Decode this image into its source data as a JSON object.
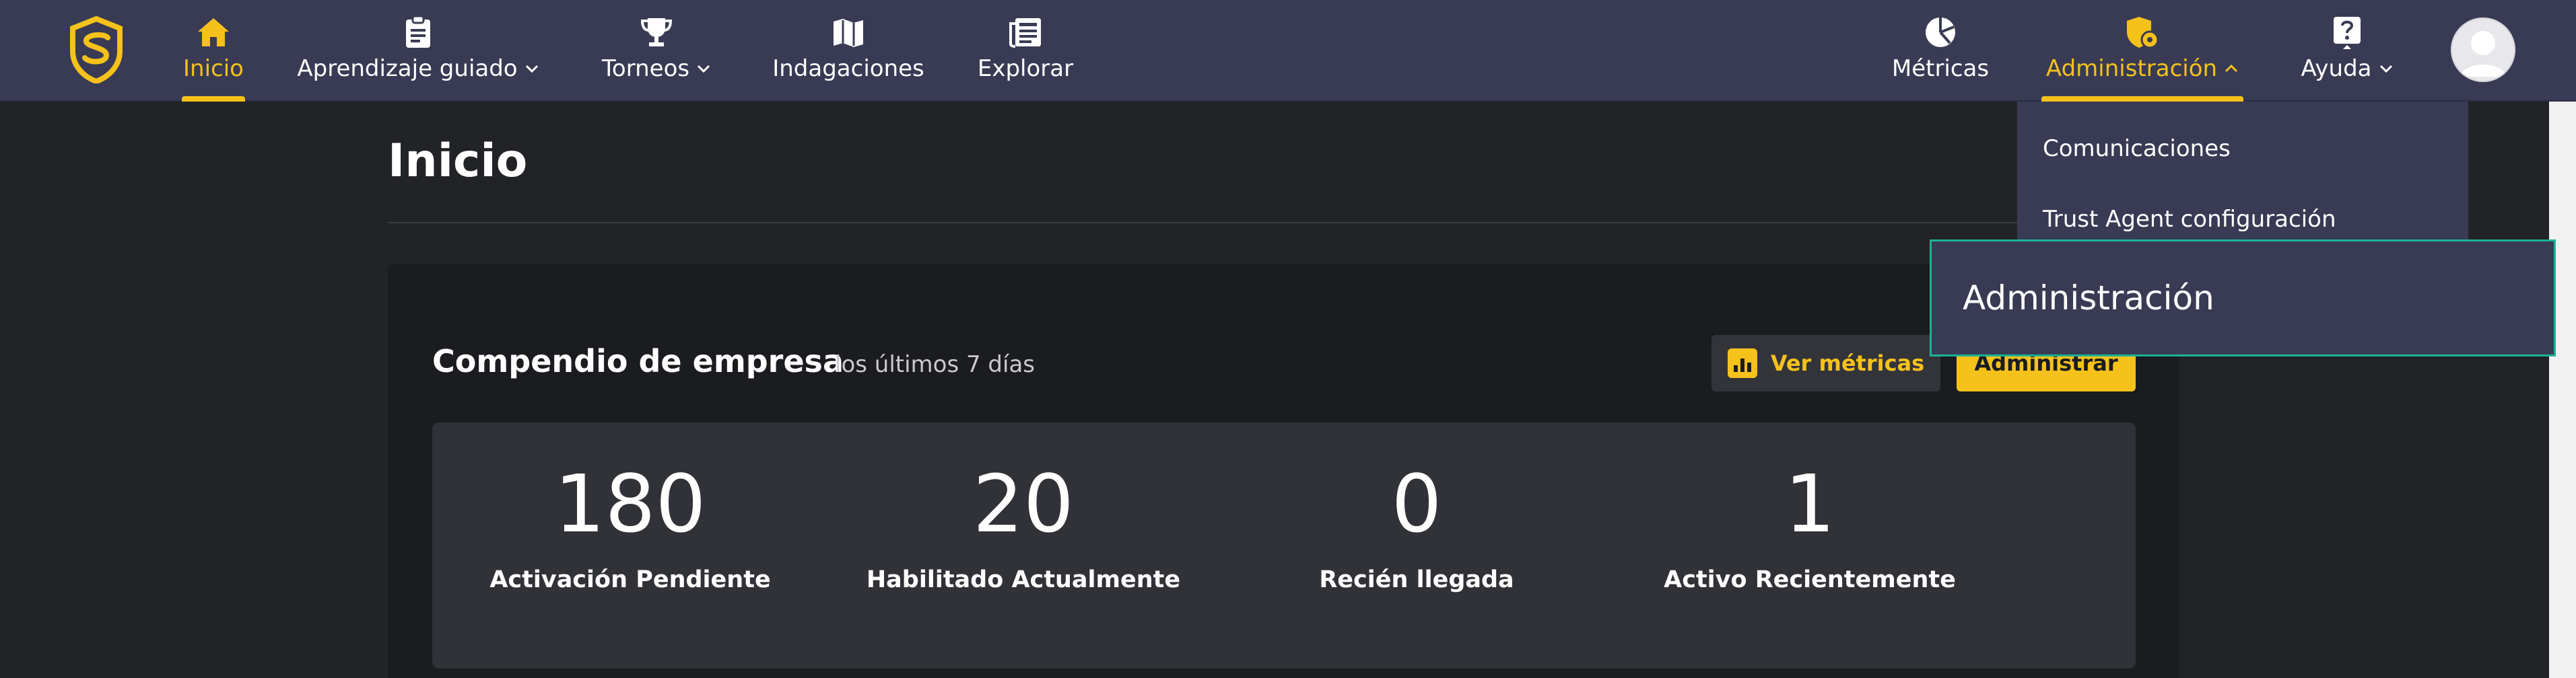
{
  "nav": {
    "items": [
      {
        "label": "Inicio",
        "icon": "home-icon",
        "active": true
      },
      {
        "label": "Aprendizaje guiado",
        "icon": "clipboard-icon",
        "dropdown": true
      },
      {
        "label": "Torneos",
        "icon": "trophy-icon",
        "dropdown": true
      },
      {
        "label": "Indagaciones",
        "icon": "map-icon"
      },
      {
        "label": "Explorar",
        "icon": "newspaper-icon"
      },
      {
        "label": "Métricas",
        "icon": "pie-chart-icon"
      },
      {
        "label": "Administración",
        "icon": "shield-gear-icon",
        "dropdown": true,
        "expanded": true,
        "highlight": true
      },
      {
        "label": "Ayuda",
        "icon": "question-icon",
        "dropdown": true
      }
    ]
  },
  "page": {
    "title": "Inicio"
  },
  "summary": {
    "title": "Compendio de empresa",
    "period": "los últimos 7 días",
    "metrics_button": "Ver métricas",
    "admin_button": "Administrar",
    "stats": [
      {
        "value": "180",
        "label": "Activación Pendiente"
      },
      {
        "value": "20",
        "label": "Habilitado Actualmente"
      },
      {
        "value": "0",
        "label": "Recién llegada"
      },
      {
        "value": "1",
        "label": "Activo Recientemente"
      }
    ]
  },
  "admin_menu": {
    "items": [
      "Comunicaciones",
      "Trust Agent configuración"
    ],
    "tooltip": "Administración"
  },
  "colors": {
    "accent": "#f5c11b",
    "nav_bg": "#393b54",
    "page_bg": "#222327",
    "card_bg": "#1b1c20",
    "stats_bg": "#313237",
    "focus_border": "#1ab394"
  }
}
